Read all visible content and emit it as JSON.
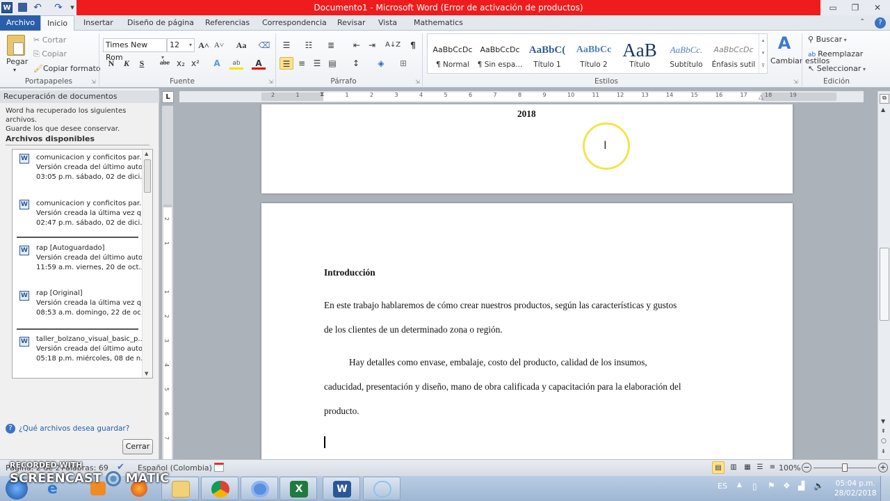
{
  "window": {
    "title": "Documento1  -  Microsoft Word (Error de activación de productos)",
    "qat": {
      "word_icon": "W",
      "save": "save-icon",
      "undo": "↶",
      "redo": "↷",
      "customize": "▾"
    },
    "controls": {
      "minimize": "▭",
      "restore": "❐",
      "close": "✕"
    }
  },
  "tabs": [
    "Archivo",
    "Inicio",
    "Insertar",
    "Diseño de página",
    "Referencias",
    "Correspondencia",
    "Revisar",
    "Vista",
    "Mathematics"
  ],
  "active_tab": "Inicio",
  "ribbon": {
    "clipboard": {
      "label": "Portapapeles",
      "paste": "Pegar",
      "cut": "Cortar",
      "copy": "Copiar",
      "format_painter": "Copiar formato"
    },
    "font": {
      "label": "Fuente",
      "font_name": "Times New Rom",
      "font_size": "12",
      "bold": "N",
      "italic": "K",
      "underline": "S",
      "strike": "abe",
      "sub": "x₂",
      "sup": "x²",
      "grow": "A˄",
      "shrink": "A˅",
      "case": "Aa"
    },
    "paragraph": {
      "label": "Párrafo",
      "pilcrow": "¶",
      "sort": "A↓Z"
    },
    "styles": {
      "label": "Estilos",
      "items": [
        {
          "sample": "AaBbCcDc",
          "name": "¶ Normal"
        },
        {
          "sample": "AaBbCcDc",
          "name": "¶ Sin espa..."
        },
        {
          "sample": "AaBbC(",
          "name": "Título 1"
        },
        {
          "sample": "AaBbCc",
          "name": "Título 2"
        },
        {
          "sample": "AaB",
          "name": "Título"
        },
        {
          "sample": "AaBbCc.",
          "name": "Subtítulo"
        },
        {
          "sample": "AaBbCcDc",
          "name": "Énfasis sutil"
        }
      ],
      "change_styles": "Cambiar estilos"
    },
    "editing": {
      "label": "Edición",
      "find": "Buscar",
      "replace": "Reemplazar",
      "select": "Seleccionar"
    }
  },
  "recovery_panel": {
    "title": "Recuperación de documentos",
    "description_line1": "Word ha recuperado los siguientes archivos.",
    "description_line2": "Guarde los que desee conservar.",
    "available_label": "Archivos disponibles",
    "files": [
      {
        "name": "comunicacion y conficitos par...",
        "version": "Versión creada del último auto...",
        "date": "03:05 p.m. sábado, 02 de dici..."
      },
      {
        "name": "comunicacion y conficitos par...",
        "version": "Versión creada la última vez q...",
        "date": "02:47 p.m. sábado, 02 de dici..."
      },
      {
        "name": "rap  [Autoguardado]",
        "version": "Versión creada del último auto...",
        "date": "11:59 a.m. viernes, 20 de oct..."
      },
      {
        "name": "rap  [Original]",
        "version": "Versión creada la última vez q...",
        "date": "08:53 a.m. domingo, 22 de oc..."
      },
      {
        "name": "taller_bolzano_visual_basic_p...",
        "version": "Versión creada del último auto...",
        "date": "05:18 p.m. miércoles, 08 de n..."
      }
    ],
    "question_link": "¿Qué archivos desea guardar?",
    "close_button": "Cerrar"
  },
  "ruler": {
    "h_labels": [
      "2",
      "1",
      "",
      "1",
      "2",
      "3",
      "4",
      "5",
      "6",
      "7",
      "8",
      "9",
      "10",
      "11",
      "12",
      "13",
      "14",
      "15",
      "16",
      "17",
      "18",
      "19"
    ],
    "v_labels": [
      "2",
      "1",
      "",
      "1",
      "2",
      "3",
      "4",
      "5",
      "6",
      "7"
    ],
    "tab_selector": "L"
  },
  "document": {
    "page1_text": "2018",
    "heading": "Introducción",
    "lines": [
      "En este trabajo hablaremos  de cómo  crear nuestros productos, según las  características  y gustos",
      "de los  clientes  de un determinado zona o región.",
      "Hay detalles como envase,  embalaje,  costo del producto, calidad de los  insumos,",
      "caducidad, presentación y diseño, mano de obra calificada y capacitación para la elaboración  del",
      "producto."
    ]
  },
  "status_bar": {
    "page": "Página: 2 de 2",
    "words": "Palabras: 69",
    "language": "Español (Colombia)",
    "zoom": "100%",
    "zoom_fraction": 0.5
  },
  "taskbar": {
    "lang": "ES",
    "time": "05:04 p.m.",
    "date": "28/02/2018"
  },
  "watermark": {
    "line1": "RECORDED WITH",
    "line2a": "SCREENCAST",
    "line2b": "MATIC"
  }
}
